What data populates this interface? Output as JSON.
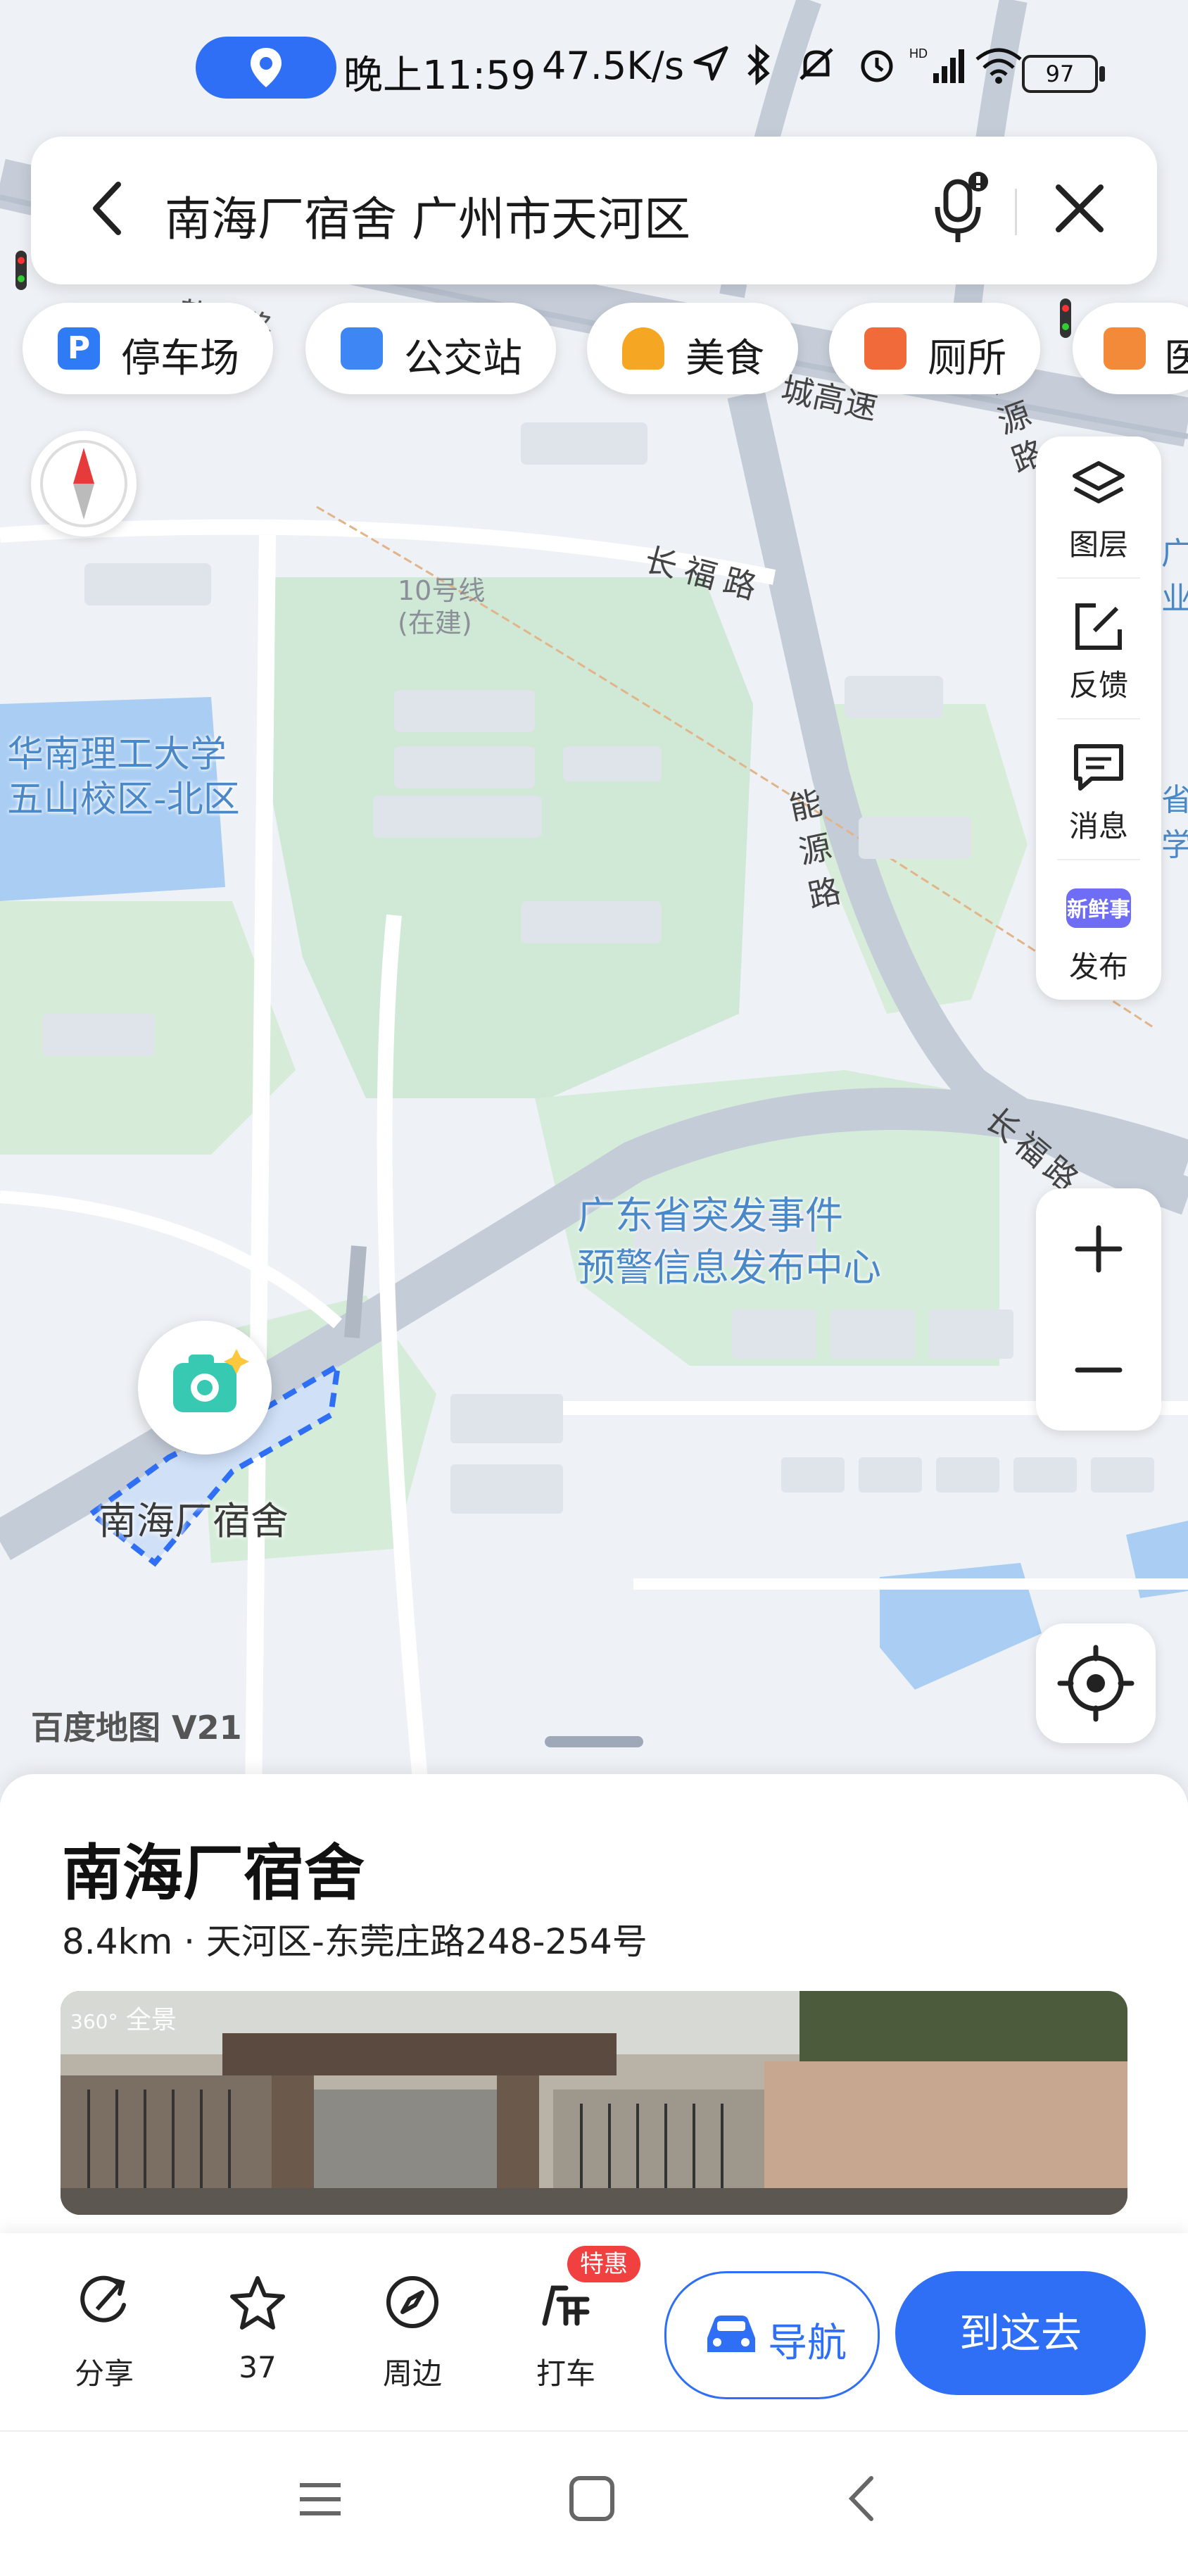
{
  "status_bar": {
    "time": "晚上11:59",
    "net_speed": "47.5K/s",
    "battery": "97"
  },
  "search": {
    "query": "南海厂宿舍 广州市天河区"
  },
  "chips": [
    {
      "label": "停车场",
      "icon": "parking-icon",
      "color": "#2f7bf5"
    },
    {
      "label": "公交站",
      "icon": "bus-stop-icon",
      "color": "#3f86f5"
    },
    {
      "label": "美食",
      "icon": "food-icon",
      "color": "#f5a623"
    },
    {
      "label": "厕所",
      "icon": "toilet-icon",
      "color": "#f06a3a"
    },
    {
      "label": "医",
      "icon": "hospital-icon",
      "color": "#f28a3a"
    }
  ],
  "tools": [
    {
      "label": "图层",
      "icon": "layers-icon"
    },
    {
      "label": "反馈",
      "icon": "feedback-icon"
    },
    {
      "label": "消息",
      "icon": "message-icon"
    },
    {
      "label": "发布",
      "icon": "publish-icon",
      "graphic_text": "新鲜事"
    }
  ],
  "map_labels": {
    "campus": "华南理工大学\n五山校区-北区",
    "center": "广东省突发事件\n预警信息发布中心",
    "metro": "10号线\n(在建)",
    "road1": "长福路",
    "road2": "能源路",
    "road3": "长福路",
    "road4": "城高速",
    "road5": "长源路",
    "road6": "黄谷路",
    "edge1": "广州市\n业",
    "edge2": "省轴\n学",
    "watermark": "百度地图 V21"
  },
  "poi": {
    "label": "南海厂宿舍"
  },
  "place": {
    "title": "南海厂宿舍",
    "subtitle": "8.4km · 天河区-东莞庄路248-254号",
    "pano_label": "全景"
  },
  "actions": [
    {
      "label": "分享",
      "icon": "share-icon"
    },
    {
      "label": "37",
      "icon": "star-icon"
    },
    {
      "label": "周边",
      "icon": "compass-nearby-icon"
    },
    {
      "label": "打车",
      "icon": "taxi-icon"
    }
  ],
  "taxi_badge": "特惠",
  "nav_button": "导航",
  "go_button": "到这去",
  "colors": {
    "accent": "#2f6ff5",
    "map_bg": "#eef1f5",
    "green": "#cfe9d6",
    "water": "#a9cdf3"
  }
}
